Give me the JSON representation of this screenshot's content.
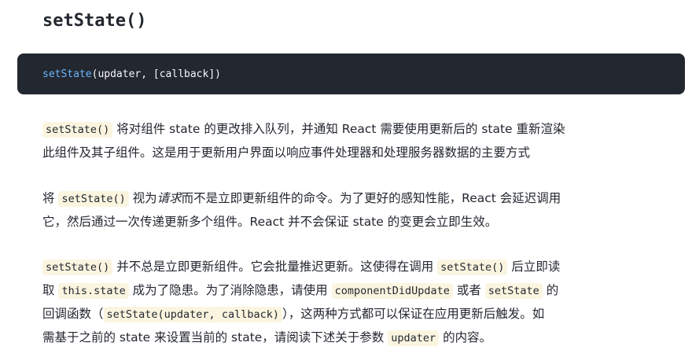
{
  "heading": {
    "title": "setState()"
  },
  "code_block": {
    "fn_name": "setState",
    "args": "(updater, [callback])"
  },
  "paragraph1": {
    "code1": "setState()",
    "text1": " 将对组件 state 的更改排入队列，并通知 React 需要使用更新后的 state 重新渲染",
    "text2": "此组件及其子组件。这是用于更新用户界面以响应事件处理器和处理服务器数据的主要方式"
  },
  "paragraph2": {
    "text1": "将 ",
    "code1": "setState()",
    "text2": " 视为",
    "em1": "请求",
    "text3": "而不是立即更新组件的命令。为了更好的感知性能，React 会延迟调用",
    "text4": "它，然后通过一次传递更新多个组件。React 并不会保证 state 的变更会立即生效。"
  },
  "paragraph3": {
    "code1": "setState()",
    "text1": " 并不总是立即更新组件。它会批量推迟更新。这使得在调用 ",
    "code2": "setState()",
    "text2": " 后立即读",
    "text3": "取 ",
    "code3": "this.state",
    "text4": " 成为了隐患。为了消除隐患，请使用 ",
    "code4": "componentDidUpdate",
    "text5": " 或者 ",
    "code5": "setState",
    "text6": " 的",
    "text7": "回调函数（",
    "code6": "setState(updater, callback)",
    "text8": "），这两种方式都可以保证在应用更新后触发。如",
    "text9": "需基于之前的 state 来设置当前的 state，请阅读下述关于参数 ",
    "code7": "updater",
    "text10": " 的内容。"
  }
}
